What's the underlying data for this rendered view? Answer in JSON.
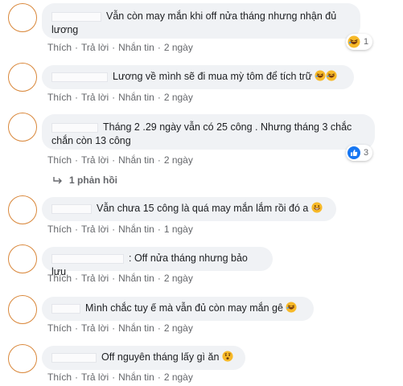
{
  "actions": {
    "like": "Thích",
    "reply": "Trả lời",
    "message": "Nhắn tin",
    "sep": "·"
  },
  "comments": [
    {
      "text": "Vẫn còn may mắn khi off nửa tháng nhưng nhận đủ\nlương",
      "time": "2 ngày",
      "reaction": {
        "icon": "laugh-emoji-icon",
        "count": "1"
      }
    },
    {
      "text": "Lương về mình sẽ đi mua mỳ tôm để tích trữ",
      "emojis": [
        "laugh-emoji-icon",
        "laugh-emoji-icon"
      ],
      "time": "2 ngày"
    },
    {
      "text": "Tháng 2 .29 ngày vẫn có 25 công . Nhưng tháng 3 chắc\nchắn còn 13 công",
      "time": "2 ngày",
      "reaction": {
        "icon": "like-icon",
        "count": "3"
      },
      "replies": "1 phản hồi"
    },
    {
      "text": "Vẫn chưa 15 công là quá may mắn lắm rồi đó a",
      "emojis": [
        "grin-emoji-icon"
      ],
      "time": "1 ngày"
    },
    {
      "text": ": Off nửa tháng nhưng bảo lưu",
      "time": "2 ngày"
    },
    {
      "text": "Mình chắc tuy ế mà vẫn đủ còn may mắn gê",
      "emojis": [
        "laugh-emoji-icon"
      ],
      "time": "2 ngày"
    },
    {
      "text": "Off nguyên tháng lấy gì ăn",
      "emojis": [
        "sad-emoji-icon"
      ],
      "time": "2 ngày"
    }
  ],
  "colors": {
    "bubble": "#f0f2f5",
    "meta": "#65676b",
    "avatar_border": "#d9873a",
    "like_blue": "#1877f2"
  }
}
